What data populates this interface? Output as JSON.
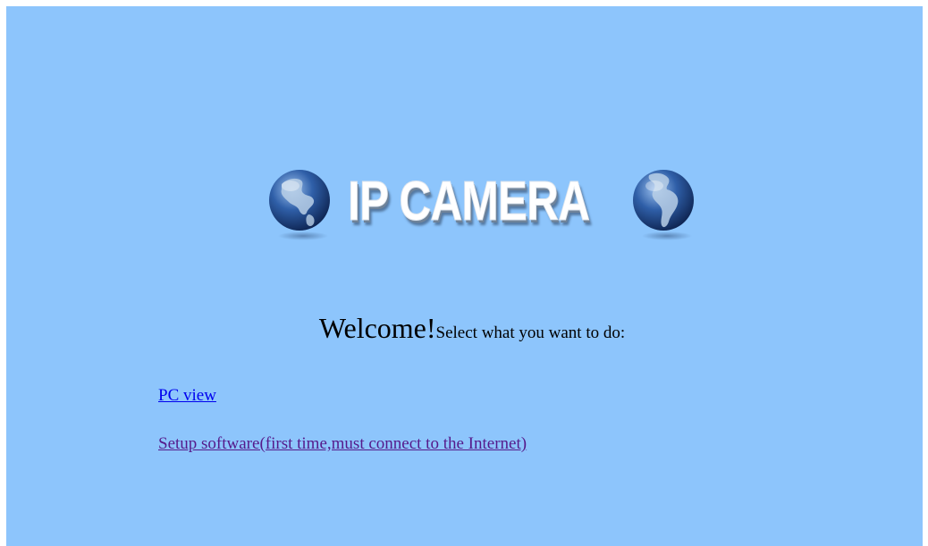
{
  "logo": {
    "title": "IP CAMERA",
    "left_icon": "globe-americas-icon",
    "right_icon": "globe-south-america-icon"
  },
  "welcome": {
    "heading": "Welcome!",
    "prompt": "Select what you want to do:"
  },
  "links": {
    "pc_view": "PC view",
    "setup_software": "Setup software(first time,must connect to the Internet)"
  },
  "colors": {
    "background": "#8dc5fc",
    "link_unvisited": "#0000ee",
    "link_visited": "#551a8b"
  }
}
